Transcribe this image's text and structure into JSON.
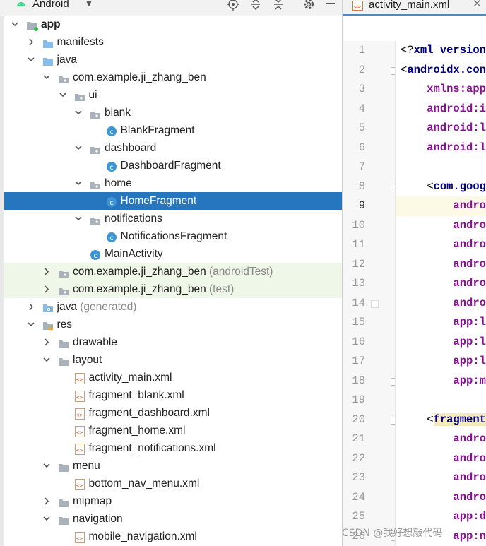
{
  "panel": {
    "project_view": "Android",
    "dropdown_icon": "chevron-down-icon",
    "toolbar_icons": [
      "locate-icon",
      "expand-all-icon",
      "collapse-all-icon",
      "gear-icon",
      "hide-icon"
    ]
  },
  "tree": [
    {
      "label": "app",
      "suffix": "",
      "depth": 0,
      "expanded": true,
      "icon": "module-icon",
      "bold": true
    },
    {
      "label": "manifests",
      "suffix": "",
      "depth": 1,
      "expanded": false,
      "icon": "folder-blue-icon"
    },
    {
      "label": "java",
      "suffix": "",
      "depth": 1,
      "expanded": true,
      "icon": "folder-blue-icon"
    },
    {
      "label": "com.example.ji_zhang_ben",
      "suffix": "",
      "depth": 2,
      "expanded": true,
      "icon": "package-icon"
    },
    {
      "label": "ui",
      "suffix": "",
      "depth": 3,
      "expanded": true,
      "icon": "package-icon"
    },
    {
      "label": "blank",
      "suffix": "",
      "depth": 4,
      "expanded": true,
      "icon": "package-icon"
    },
    {
      "label": "BlankFragment",
      "suffix": "",
      "depth": 5,
      "expanded": null,
      "icon": "class-icon"
    },
    {
      "label": "dashboard",
      "suffix": "",
      "depth": 4,
      "expanded": true,
      "icon": "package-icon"
    },
    {
      "label": "DashboardFragment",
      "suffix": "",
      "depth": 5,
      "expanded": null,
      "icon": "class-icon"
    },
    {
      "label": "home",
      "suffix": "",
      "depth": 4,
      "expanded": true,
      "icon": "package-icon"
    },
    {
      "label": "HomeFragment",
      "suffix": "",
      "depth": 5,
      "expanded": null,
      "icon": "class-icon",
      "selected": true
    },
    {
      "label": "notifications",
      "suffix": "",
      "depth": 4,
      "expanded": true,
      "icon": "package-icon"
    },
    {
      "label": "NotificationsFragment",
      "suffix": "",
      "depth": 5,
      "expanded": null,
      "icon": "class-icon"
    },
    {
      "label": "MainActivity",
      "suffix": "",
      "depth": 4,
      "expanded": null,
      "icon": "class-icon"
    },
    {
      "label": "com.example.ji_zhang_ben",
      "suffix": "(androidTest)",
      "depth": 2,
      "expanded": false,
      "icon": "package-icon",
      "test": true
    },
    {
      "label": "com.example.ji_zhang_ben",
      "suffix": "(test)",
      "depth": 2,
      "expanded": false,
      "icon": "package-icon",
      "test": true
    },
    {
      "label": "java",
      "suffix": "(generated)",
      "depth": 1,
      "expanded": false,
      "icon": "folder-generated-icon"
    },
    {
      "label": "res",
      "suffix": "",
      "depth": 1,
      "expanded": true,
      "icon": "res-folder-icon"
    },
    {
      "label": "drawable",
      "suffix": "",
      "depth": 2,
      "expanded": false,
      "icon": "folder-icon"
    },
    {
      "label": "layout",
      "suffix": "",
      "depth": 2,
      "expanded": true,
      "icon": "folder-icon"
    },
    {
      "label": "activity_main.xml",
      "suffix": "",
      "depth": 3,
      "expanded": null,
      "icon": "xml-file-icon"
    },
    {
      "label": "fragment_blank.xml",
      "suffix": "",
      "depth": 3,
      "expanded": null,
      "icon": "xml-file-icon"
    },
    {
      "label": "fragment_dashboard.xml",
      "suffix": "",
      "depth": 3,
      "expanded": null,
      "icon": "xml-file-icon"
    },
    {
      "label": "fragment_home.xml",
      "suffix": "",
      "depth": 3,
      "expanded": null,
      "icon": "xml-file-icon"
    },
    {
      "label": "fragment_notifications.xml",
      "suffix": "",
      "depth": 3,
      "expanded": null,
      "icon": "xml-file-icon"
    },
    {
      "label": "menu",
      "suffix": "",
      "depth": 2,
      "expanded": true,
      "icon": "folder-icon"
    },
    {
      "label": "bottom_nav_menu.xml",
      "suffix": "",
      "depth": 3,
      "expanded": null,
      "icon": "xml-file-icon"
    },
    {
      "label": "mipmap",
      "suffix": "",
      "depth": 2,
      "expanded": false,
      "icon": "folder-icon"
    },
    {
      "label": "navigation",
      "suffix": "",
      "depth": 2,
      "expanded": true,
      "icon": "folder-icon"
    },
    {
      "label": "mobile_navigation.xml",
      "suffix": "",
      "depth": 3,
      "expanded": null,
      "icon": "xml-file-icon"
    }
  ],
  "editor": {
    "tab_label": "activity_main.xml",
    "tab_icon": "xml-file-icon",
    "close_icon": "close-icon",
    "current_line": 9,
    "lines": [
      {
        "n": "1",
        "parts": [
          {
            "t": "<?",
            "c": "punct"
          },
          {
            "t": "xml version",
            "c": "tag"
          }
        ]
      },
      {
        "n": "2",
        "parts": [
          {
            "t": "<",
            "c": "punct"
          },
          {
            "t": "androidx.con",
            "c": "tag"
          }
        ]
      },
      {
        "n": "3",
        "parts": [
          {
            "t": "    ",
            "c": "punct"
          },
          {
            "t": "xmlns:app",
            "c": "attr"
          }
        ]
      },
      {
        "n": "4",
        "parts": [
          {
            "t": "    ",
            "c": "punct"
          },
          {
            "t": "android:i",
            "c": "attr"
          }
        ]
      },
      {
        "n": "5",
        "parts": [
          {
            "t": "    ",
            "c": "punct"
          },
          {
            "t": "android:l",
            "c": "attr"
          }
        ]
      },
      {
        "n": "6",
        "parts": [
          {
            "t": "    ",
            "c": "punct"
          },
          {
            "t": "android:l",
            "c": "attr"
          }
        ]
      },
      {
        "n": "7",
        "parts": []
      },
      {
        "n": "8",
        "parts": [
          {
            "t": "    <",
            "c": "punct"
          },
          {
            "t": "com.goog",
            "c": "tag"
          }
        ]
      },
      {
        "n": "9",
        "parts": [
          {
            "t": "        ",
            "c": "punct"
          },
          {
            "t": "andro",
            "c": "attr"
          }
        ]
      },
      {
        "n": "10",
        "parts": [
          {
            "t": "        ",
            "c": "punct"
          },
          {
            "t": "andro",
            "c": "attr"
          }
        ]
      },
      {
        "n": "11",
        "parts": [
          {
            "t": "        ",
            "c": "punct"
          },
          {
            "t": "andro",
            "c": "attr"
          }
        ]
      },
      {
        "n": "12",
        "parts": [
          {
            "t": "        ",
            "c": "punct"
          },
          {
            "t": "andro",
            "c": "attr"
          }
        ]
      },
      {
        "n": "13",
        "parts": [
          {
            "t": "        ",
            "c": "punct"
          },
          {
            "t": "andro",
            "c": "attr"
          }
        ]
      },
      {
        "n": "14",
        "parts": [
          {
            "t": "        ",
            "c": "punct"
          },
          {
            "t": "andro",
            "c": "attr"
          }
        ]
      },
      {
        "n": "15",
        "parts": [
          {
            "t": "        ",
            "c": "punct"
          },
          {
            "t": "app:l",
            "c": "attr"
          }
        ]
      },
      {
        "n": "16",
        "parts": [
          {
            "t": "        ",
            "c": "punct"
          },
          {
            "t": "app:l",
            "c": "attr"
          }
        ]
      },
      {
        "n": "17",
        "parts": [
          {
            "t": "        ",
            "c": "punct"
          },
          {
            "t": "app:l",
            "c": "attr"
          }
        ]
      },
      {
        "n": "18",
        "parts": [
          {
            "t": "        ",
            "c": "punct"
          },
          {
            "t": "app:m",
            "c": "attr"
          }
        ]
      },
      {
        "n": "19",
        "parts": []
      },
      {
        "n": "20",
        "parts": [
          {
            "t": "    <",
            "c": "punct"
          },
          {
            "t": "fragment",
            "c": "tag hl"
          }
        ]
      },
      {
        "n": "21",
        "parts": [
          {
            "t": "        ",
            "c": "punct"
          },
          {
            "t": "andro",
            "c": "attr"
          }
        ]
      },
      {
        "n": "22",
        "parts": [
          {
            "t": "        ",
            "c": "punct"
          },
          {
            "t": "andro",
            "c": "attr"
          }
        ]
      },
      {
        "n": "23",
        "parts": [
          {
            "t": "        ",
            "c": "punct"
          },
          {
            "t": "andro",
            "c": "attr"
          }
        ]
      },
      {
        "n": "24",
        "parts": [
          {
            "t": "        ",
            "c": "punct"
          },
          {
            "t": "andro",
            "c": "attr"
          }
        ]
      },
      {
        "n": "25",
        "parts": [
          {
            "t": "        ",
            "c": "punct"
          },
          {
            "t": "app:d",
            "c": "attr"
          }
        ]
      },
      {
        "n": "26",
        "parts": [
          {
            "t": "        ",
            "c": "punct"
          },
          {
            "t": "app:n",
            "c": "attr"
          }
        ]
      }
    ]
  },
  "watermark": "CSDN @我好想敲代码",
  "colors": {
    "selection": "#2675bf",
    "test_row_bg": "#eef7e8",
    "xml_tag": "#000080",
    "xml_attr": "#871094",
    "current_line_bg": "#fcfae5",
    "class_icon": "#3d95d4"
  }
}
